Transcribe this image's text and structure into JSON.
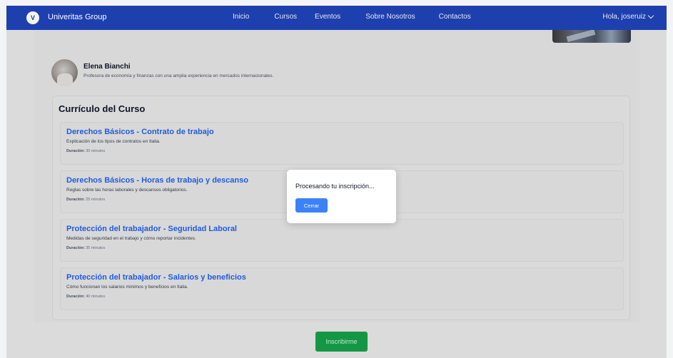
{
  "navbar": {
    "logo_text": "V",
    "brand": "Univeritas Group",
    "links": [
      "Inicio",
      "Cursos",
      "Eventos",
      "Sobre Nosotros",
      "Contactos"
    ],
    "user_greeting": "Hola, joseruiz"
  },
  "instructor": {
    "name": "Elena Bianchi",
    "description": "Profesora de economía y finanzas con una amplia experiencia en mercados internacionales."
  },
  "curriculum": {
    "title": "Currículo del Curso",
    "duration_label": "Duración:",
    "lessons": [
      {
        "title": "Derechos Básicos - Contrato de trabajo",
        "description": "Explicación de los tipos de contratos en Italia.",
        "duration": "30 minutos"
      },
      {
        "title": "Derechos Básicos - Horas de trabajo y descanso",
        "description": "Reglas sobre las horas laborales y descansos obligatorios.",
        "duration": "25 minutos"
      },
      {
        "title": "Protección del trabajador - Seguridad Laboral",
        "description": "Medidas de seguridad en el trabajo y cómo reportar incidentes.",
        "duration": "35 minutos"
      },
      {
        "title": "Protección del trabajador - Salarios y beneficios",
        "description": "Cómo funcionan los salarios mínimos y beneficios en Italia.",
        "duration": "40 minutos"
      }
    ]
  },
  "enroll_button": "Inscribirme",
  "modal": {
    "message": "Procesando tu inscripción...",
    "close_label": "Cerrar"
  },
  "colors": {
    "navbar": "#1e40af",
    "lesson_title": "#2563eb",
    "enroll": "#16a34a",
    "modal_button": "#3b82f6"
  }
}
